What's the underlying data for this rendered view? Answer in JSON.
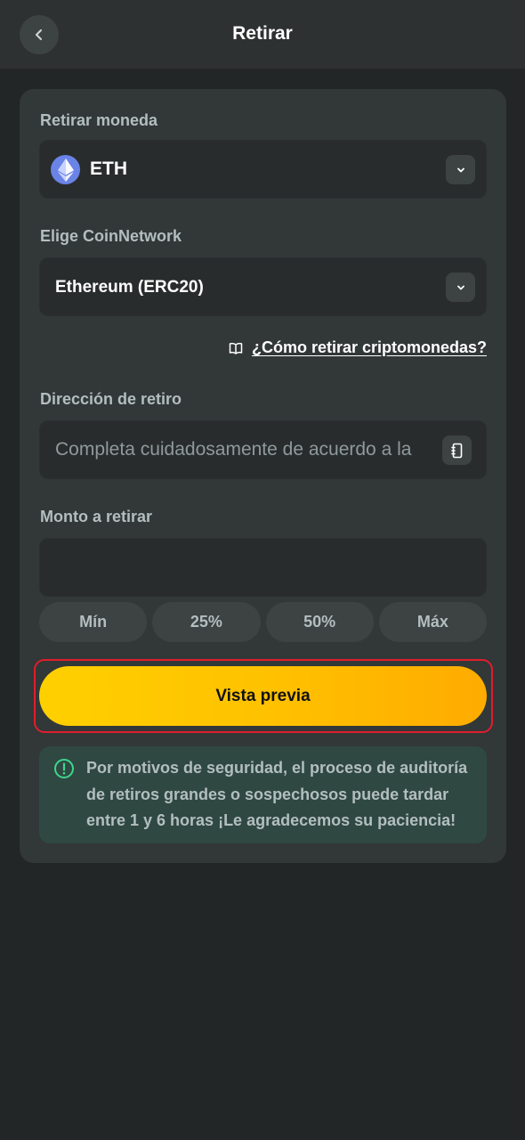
{
  "header": {
    "title": "Retirar",
    "back_icon": "chevron-left-icon"
  },
  "coin": {
    "label": "Retirar moneda",
    "selected": "ETH",
    "icon": "ethereum-icon"
  },
  "network": {
    "label": "Elige CoinNetwork",
    "selected": "Ethereum (ERC20)"
  },
  "help_link": {
    "text": "¿Cómo retirar criptomonedas?",
    "icon": "book-icon"
  },
  "address": {
    "label": "Dirección de retiro",
    "placeholder": "Completa cuidadosamente de acuerdo a la",
    "value": ""
  },
  "amount": {
    "label": "Monto a retirar",
    "value": "",
    "presets": [
      "Mín",
      "25%",
      "50%",
      "Máx"
    ]
  },
  "preview_button": {
    "label": "Vista previa"
  },
  "notice": {
    "text": "Por motivos de seguridad, el proceso de auditoría de retiros grandes o sospechosos puede tardar entre 1 y 6 horas ¡Le agradecemos su paciencia!",
    "icon": "info-circle-icon"
  },
  "colors": {
    "background": "#232626",
    "card": "#323738",
    "field": "#292c2d",
    "accent_start": "#ffd000",
    "accent_end": "#ffab00",
    "highlight": "#e01e2c",
    "notice_bg": "#2f4842",
    "notice_icon": "#3dd68c"
  }
}
